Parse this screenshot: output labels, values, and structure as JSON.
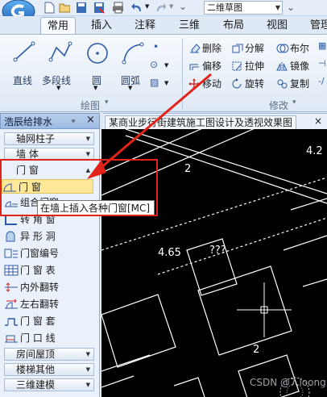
{
  "titlebar": {
    "view_mode": "二维草图"
  },
  "ribbon": {
    "tabs": [
      {
        "label": "常用",
        "active": true
      },
      {
        "label": "插入"
      },
      {
        "label": "注释"
      },
      {
        "label": "三维"
      },
      {
        "label": "布局"
      },
      {
        "label": "视图"
      },
      {
        "label": "管理"
      }
    ],
    "draw_group": {
      "label": "绘图",
      "line": "直线",
      "polyline": "多段线",
      "circle": "圆",
      "arc": "圆弧"
    },
    "modify_group": {
      "label": "修改",
      "erase": "删除",
      "explode": "分解",
      "boolean": "布尔",
      "offset": "偏移",
      "stretch": "拉伸",
      "mirror": "镜像",
      "move": "移动",
      "rotate": "旋转",
      "copy": "复制"
    }
  },
  "left_panel": {
    "title": "浩辰给排水",
    "pin": "ᵩ",
    "close": "×",
    "categories": {
      "axis_column": "轴网柱子",
      "wall": "墙    体",
      "door_window": "门    窗",
      "room_roof": "房间屋顶",
      "stair_other": "楼梯其他",
      "model_3d": "三维建模"
    },
    "items": {
      "door_window": "门    窗",
      "combo_door_window": "组合门窗",
      "corner_window": "转 角 窗",
      "special_hole": "异 形 洞",
      "door_window_number": "门窗编号",
      "door_window_table": "门 窗 表",
      "flip_inside_out": "内外翻转",
      "flip_left_right": "左右翻转",
      "door_window_frame": "门 窗 套",
      "door_sill_line": "门 口 线"
    }
  },
  "document": {
    "tab_title": "某商业步行街建筑施工图设计及透视效果图"
  },
  "canvas": {
    "labels": {
      "room_number_top": "2",
      "elev_right": "4.2",
      "elev_left": "4.65",
      "unknown": "???",
      "room_number_bottom": "2"
    }
  },
  "tooltip": {
    "text": "在墙上插入各种门窗[MC]"
  },
  "watermark": {
    "text": "CSDN @7.loong"
  },
  "colors": {
    "annotation_red": "#e2231a",
    "canvas_bg": "#000000",
    "ribbon_bg": "#dfe9f5"
  }
}
